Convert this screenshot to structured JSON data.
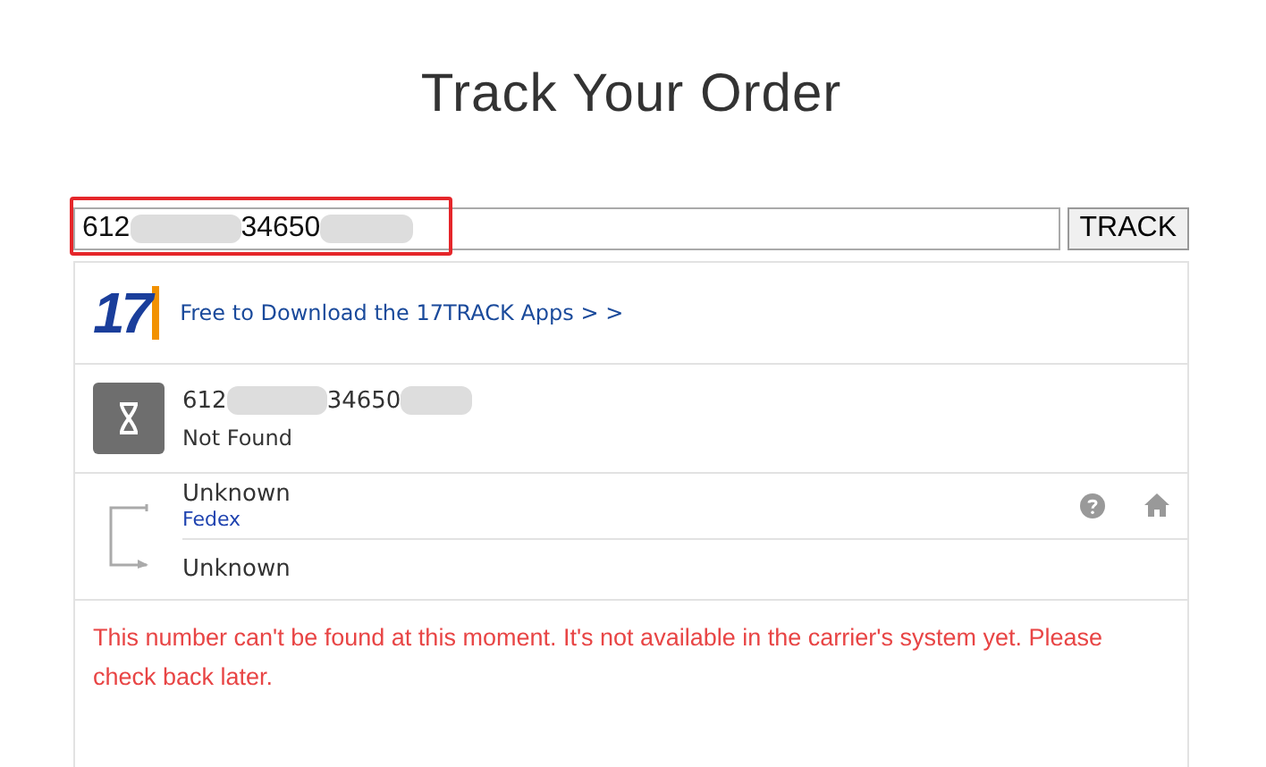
{
  "title": "Track Your Order",
  "search": {
    "value_parts": [
      "612",
      "34650"
    ],
    "highlighted": true,
    "button": "TRACK"
  },
  "app_banner": {
    "logo_text": "17",
    "link": "Free to Download the 17TRACK Apps  >  >"
  },
  "result": {
    "number_parts": [
      "612",
      "34650"
    ],
    "status": "Not Found"
  },
  "route": {
    "origin": "Unknown",
    "carrier": "Fedex",
    "destination": "Unknown"
  },
  "message": "This number can't be found at this moment. It's not available in the carrier's system yet. Please check back later."
}
